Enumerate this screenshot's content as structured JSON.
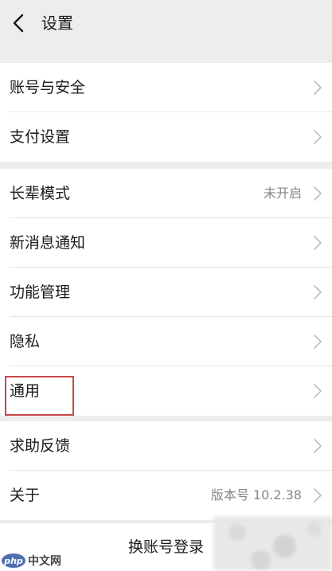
{
  "header": {
    "title": "设置",
    "back_icon": "chevron-left-icon"
  },
  "groups": [
    {
      "items": [
        {
          "label": "账号与安全",
          "value": ""
        },
        {
          "label": "支付设置",
          "value": ""
        }
      ]
    },
    {
      "items": [
        {
          "label": "长辈模式",
          "value": "未开启"
        },
        {
          "label": "新消息通知",
          "value": ""
        },
        {
          "label": "功能管理",
          "value": ""
        },
        {
          "label": "隐私",
          "value": ""
        },
        {
          "label": "通用",
          "value": ""
        }
      ]
    },
    {
      "items": [
        {
          "label": "求助反馈",
          "value": ""
        },
        {
          "label": "关于",
          "value": "版本号 10.2.38"
        }
      ]
    }
  ],
  "switch_account": {
    "label": "换账号登录"
  },
  "watermark": {
    "logo": "php",
    "text": "中文网"
  },
  "colors": {
    "background": "#ededed",
    "card": "#ffffff",
    "highlight_border": "#c9474a",
    "secondary_text": "#888888"
  }
}
